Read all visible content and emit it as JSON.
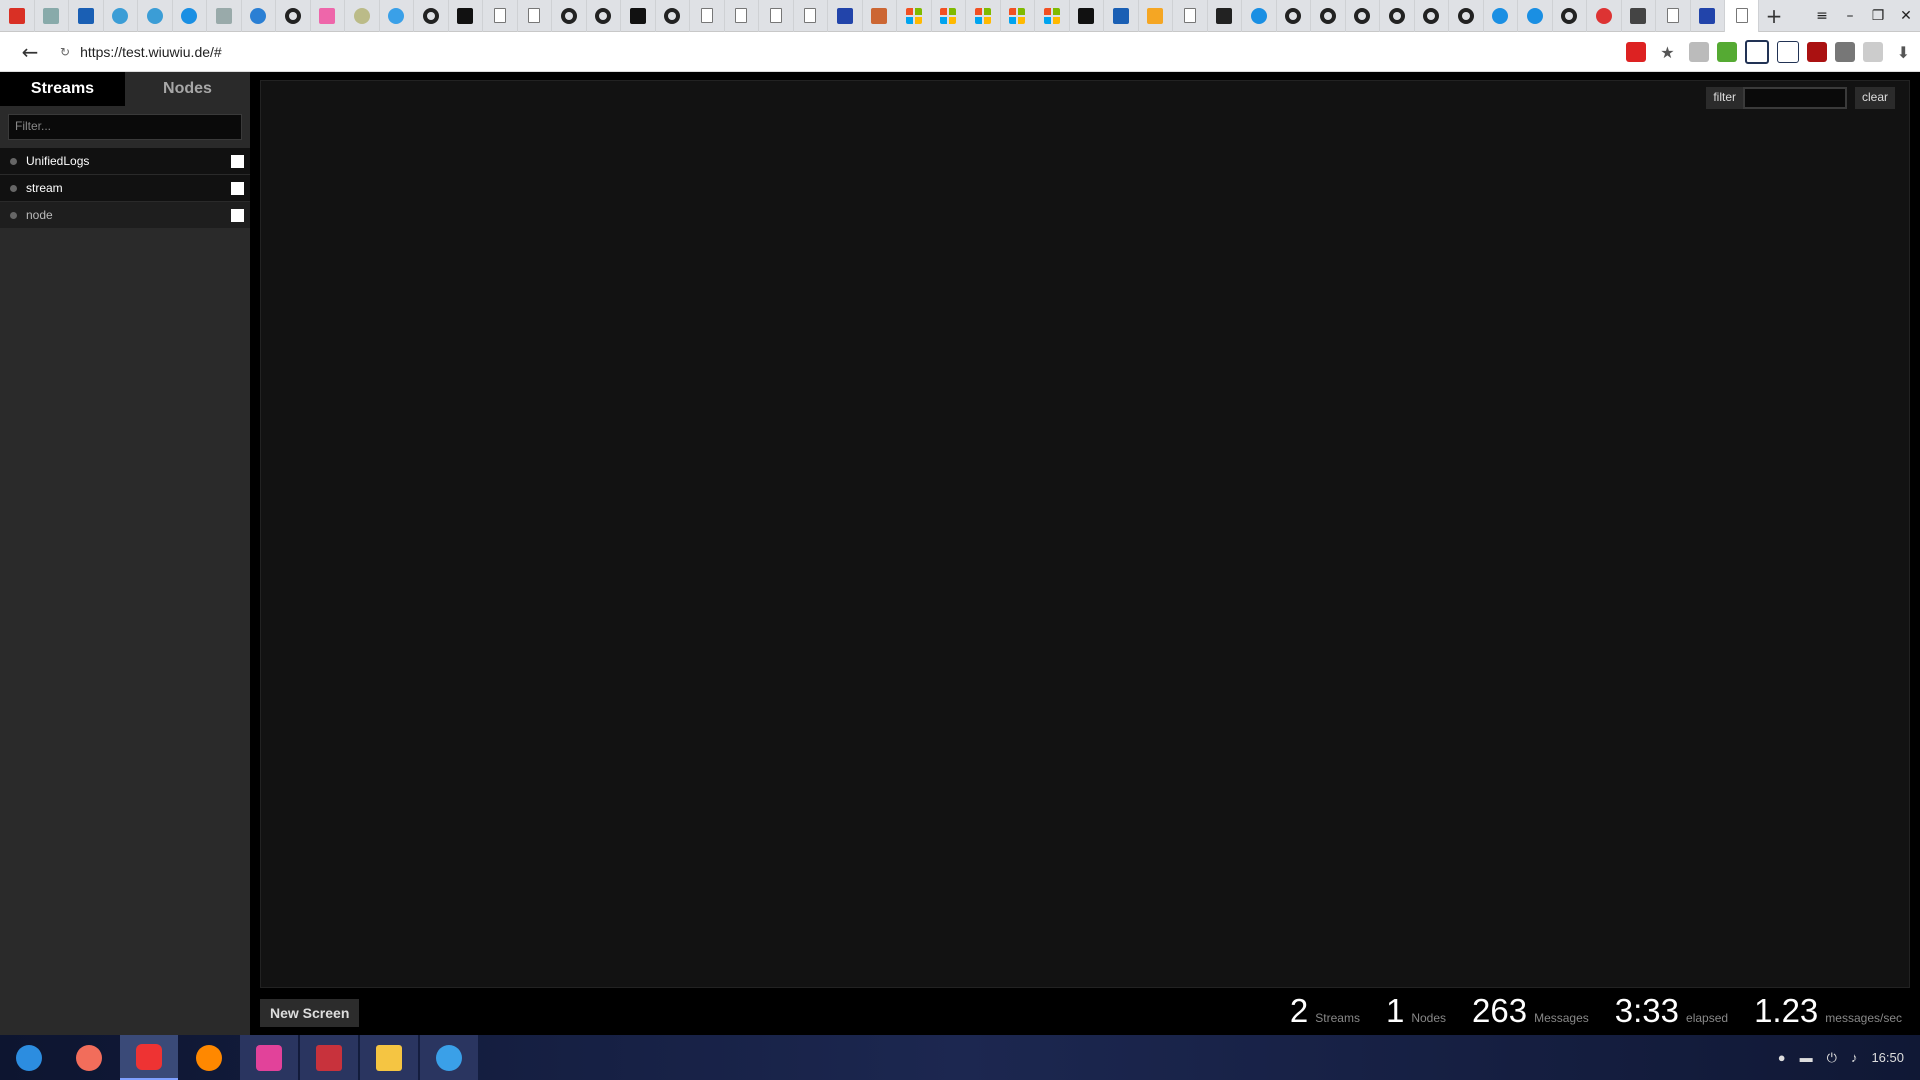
{
  "browser": {
    "url": "https://test.wiuwiu.de/#",
    "new_tab": "+",
    "back": "←",
    "reload": "↻",
    "star": "★",
    "download": "⬇",
    "tab_icons": [
      "gmail-icon",
      "image-icon",
      "b-icon",
      "chat-icon",
      "chat-icon",
      "blue-circle-icon",
      "monitor-icon",
      "refresh-icon",
      "github-icon",
      "rainbow-icon",
      "face-icon",
      "swirl-icon",
      "github-icon",
      "five-icon",
      "doc-icon",
      "doc-icon",
      "github-icon",
      "github-icon",
      "five-icon",
      "github-icon",
      "doc-icon",
      "doc-icon",
      "doc-icon",
      "doc-icon",
      "tools-icon",
      "fox-icon",
      "microsoft-icon",
      "microsoft-icon",
      "microsoft-icon",
      "microsoft-icon",
      "microsoft-icon",
      "five-icon",
      "wave-icon",
      "shield-icon",
      "doc-icon",
      "note-icon",
      "blue-circle-icon",
      "github-icon",
      "github-icon",
      "github-icon",
      "github-icon",
      "github-icon",
      "github-icon",
      "blue-circle-icon",
      "blue-circle-icon",
      "github-icon",
      "red-circle-icon",
      "spiral-icon",
      "doc-icon",
      "tools-icon",
      "doc-icon"
    ],
    "window_controls": {
      "menu": "≡",
      "minimize": "–",
      "restore": "❐",
      "close": "✕"
    }
  },
  "sidebar": {
    "tabs": [
      {
        "label": "Streams",
        "active": true
      },
      {
        "label": "Nodes",
        "active": false
      }
    ],
    "filter_placeholder": "Filter...",
    "streams": [
      {
        "label": "UnifiedLogs"
      },
      {
        "label": "stream"
      },
      {
        "label": "node"
      }
    ]
  },
  "main": {
    "filter_label": "filter",
    "filter_value": "",
    "clear_label": "clear",
    "new_screen_label": "New Screen",
    "stats": [
      {
        "num": "2",
        "unit": "Streams"
      },
      {
        "num": "1",
        "unit": "Nodes"
      },
      {
        "num": "263",
        "unit": "Messages"
      },
      {
        "num": "3:33",
        "unit": "elapsed"
      },
      {
        "num": "1.23",
        "unit": "messages/sec"
      }
    ]
  },
  "taskbar": {
    "clock": "16:50",
    "apps": [
      "start-icon",
      "app-circle-icon",
      "vivaldi-icon",
      "firefox-icon",
      "pink-app-icon",
      "terminal-icon",
      "files-icon",
      "search-app-icon"
    ]
  }
}
